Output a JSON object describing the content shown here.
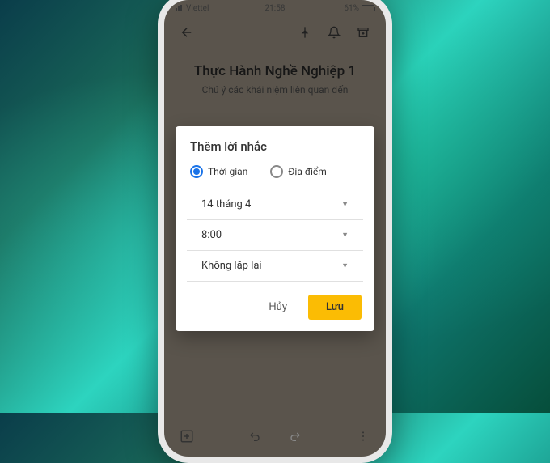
{
  "statusbar": {
    "carrier": "Viettel",
    "time": "21:58",
    "battery_pct": "61%"
  },
  "note": {
    "title": "Thực Hành Nghề Nghiệp 1",
    "subtitle": "Chú ý các khái niệm liên quan đến"
  },
  "dialog": {
    "title": "Thêm lời nhắc",
    "radio_time": "Thời gian",
    "radio_place": "Địa điểm",
    "date": "14 tháng 4",
    "time": "8:00",
    "repeat": "Không lặp lại",
    "cancel": "Hủy",
    "save": "Lưu"
  }
}
